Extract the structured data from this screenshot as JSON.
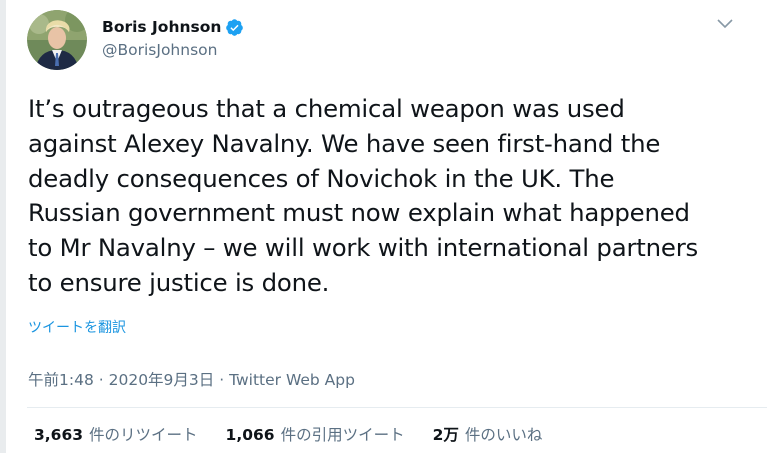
{
  "user": {
    "name": "Boris Johnson",
    "handle": "@BorisJohnson",
    "verified": true
  },
  "tweet": {
    "text": "It’s outrageous that a chemical weapon was used\nagainst Alexey Navalny. We have seen first-hand the\ndeadly consequences of Novichok in the UK. The\nRussian government must now explain what happened\nto Mr Navalny – we will work with international partners\nto ensure justice is done.",
    "translate_label": "ツイートを翻訳",
    "time": "午前1:48",
    "date": "2020年9月3日",
    "source": "Twitter Web App",
    "separator": "·"
  },
  "stats": {
    "retweets": {
      "num": "3,663",
      "label": "件のリツイート"
    },
    "quotes": {
      "num": "1,066",
      "label": "件の引用ツイート"
    },
    "likes": {
      "num": "2万",
      "label": "件のいいね"
    }
  },
  "colors": {
    "verified": "#1da1f2",
    "link": "#1b95e0",
    "secondary": "#5b7083"
  }
}
